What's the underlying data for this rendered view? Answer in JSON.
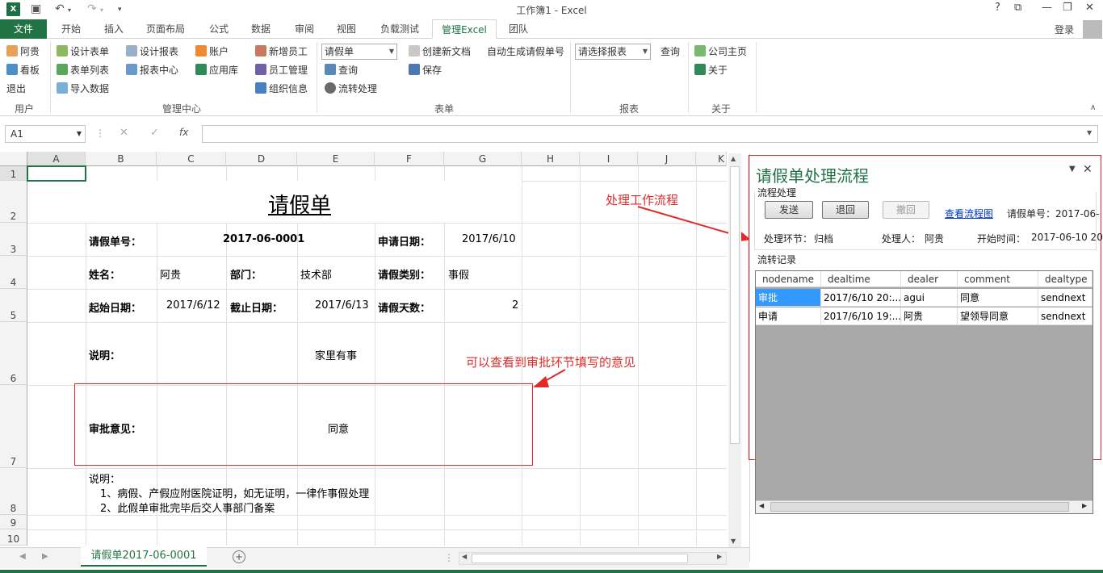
{
  "window": {
    "title": "工作簿1 - Excel",
    "help": "?",
    "login": "登录"
  },
  "tabs": [
    "文件",
    "开始",
    "插入",
    "页面布局",
    "公式",
    "数据",
    "审阅",
    "视图",
    "负载测试",
    "管理Excel",
    "团队"
  ],
  "ribbon": {
    "user": {
      "items": [
        "阿贵",
        "看板",
        "退出"
      ],
      "group": "用户"
    },
    "mgmt": {
      "col1": [
        "设计表单",
        "表单列表",
        "导入数据"
      ],
      "col2": [
        "设计报表",
        "报表中心"
      ],
      "col3": [
        "账户",
        "应用库"
      ],
      "col4": [
        "新增员工",
        "员工管理",
        "组织信息"
      ],
      "group": "管理中心"
    },
    "form": {
      "combo": "请假单",
      "items": [
        "查询",
        "流转处理"
      ],
      "col2": [
        "创建新文档",
        "保存"
      ],
      "auto": "自动生成请假单号",
      "group": "表单"
    },
    "report": {
      "combo": "请选择报表",
      "query": "查询",
      "group": "报表"
    },
    "about": {
      "items": [
        "公司主页",
        "关于"
      ],
      "group": "关于"
    }
  },
  "formula_bar": {
    "namebox": "A1",
    "fx": "fx",
    "value": ""
  },
  "columns": [
    "A",
    "B",
    "C",
    "D",
    "E",
    "F",
    "G",
    "H",
    "I",
    "J",
    "K"
  ],
  "rows": [
    "1",
    "2",
    "3",
    "4",
    "5",
    "6",
    "7",
    "8",
    "9",
    "10"
  ],
  "form": {
    "title": "请假单",
    "no_label": "请假单号：",
    "no_value": "2017-06-0001",
    "apply_label": "申请日期：",
    "apply_value": "2017/6/10",
    "name_label": "姓名：",
    "name_value": "阿贵",
    "dept_label": "部门：",
    "dept_value": "技术部",
    "type_label": "请假类别：",
    "type_value": "事假",
    "start_label": "起始日期：",
    "start_value": "2017/6/12",
    "end_label": "截止日期：",
    "end_value": "2017/6/13",
    "days_label": "请假天数：",
    "days_value": "2",
    "desc_label": "说明：",
    "desc_value": "家里有事",
    "opinion_label": "审批意见：",
    "opinion_value": "同意",
    "notes_title": "说明：",
    "note1": "1、病假、产假应附医院证明，如无证明，一律作事假处理",
    "note2": "2、此假单审批完毕后交人事部门备案"
  },
  "annotations": {
    "flow": "处理工作流程",
    "opinion": "可以查看到审批环节填写的意见"
  },
  "sheet_tab": "请假单2017-06-0001",
  "panel": {
    "title": "请假单处理流程",
    "section1": "流程处理",
    "buttons": {
      "send": "发送",
      "back": "退回",
      "revoke": "撤回"
    },
    "view_link": "查看流程图",
    "no_label": "请假单号：2017-06-",
    "node_label": "处理环节：",
    "node_value": "归档",
    "handler_label": "处理人：",
    "handler_value": "阿贵",
    "start_label": "开始时间：",
    "start_value": "2017-06-10 20",
    "section2": "流转记录",
    "grid_headers": [
      "nodename",
      "dealtime",
      "dealer",
      "comment",
      "dealtype"
    ],
    "grid_rows": [
      [
        "审批",
        "2017/6/10 20:...",
        "agui",
        "同意",
        "sendnext"
      ],
      [
        "申请",
        "2017/6/10 19:...",
        "阿贵",
        "望领导同意",
        "sendnext"
      ]
    ]
  }
}
